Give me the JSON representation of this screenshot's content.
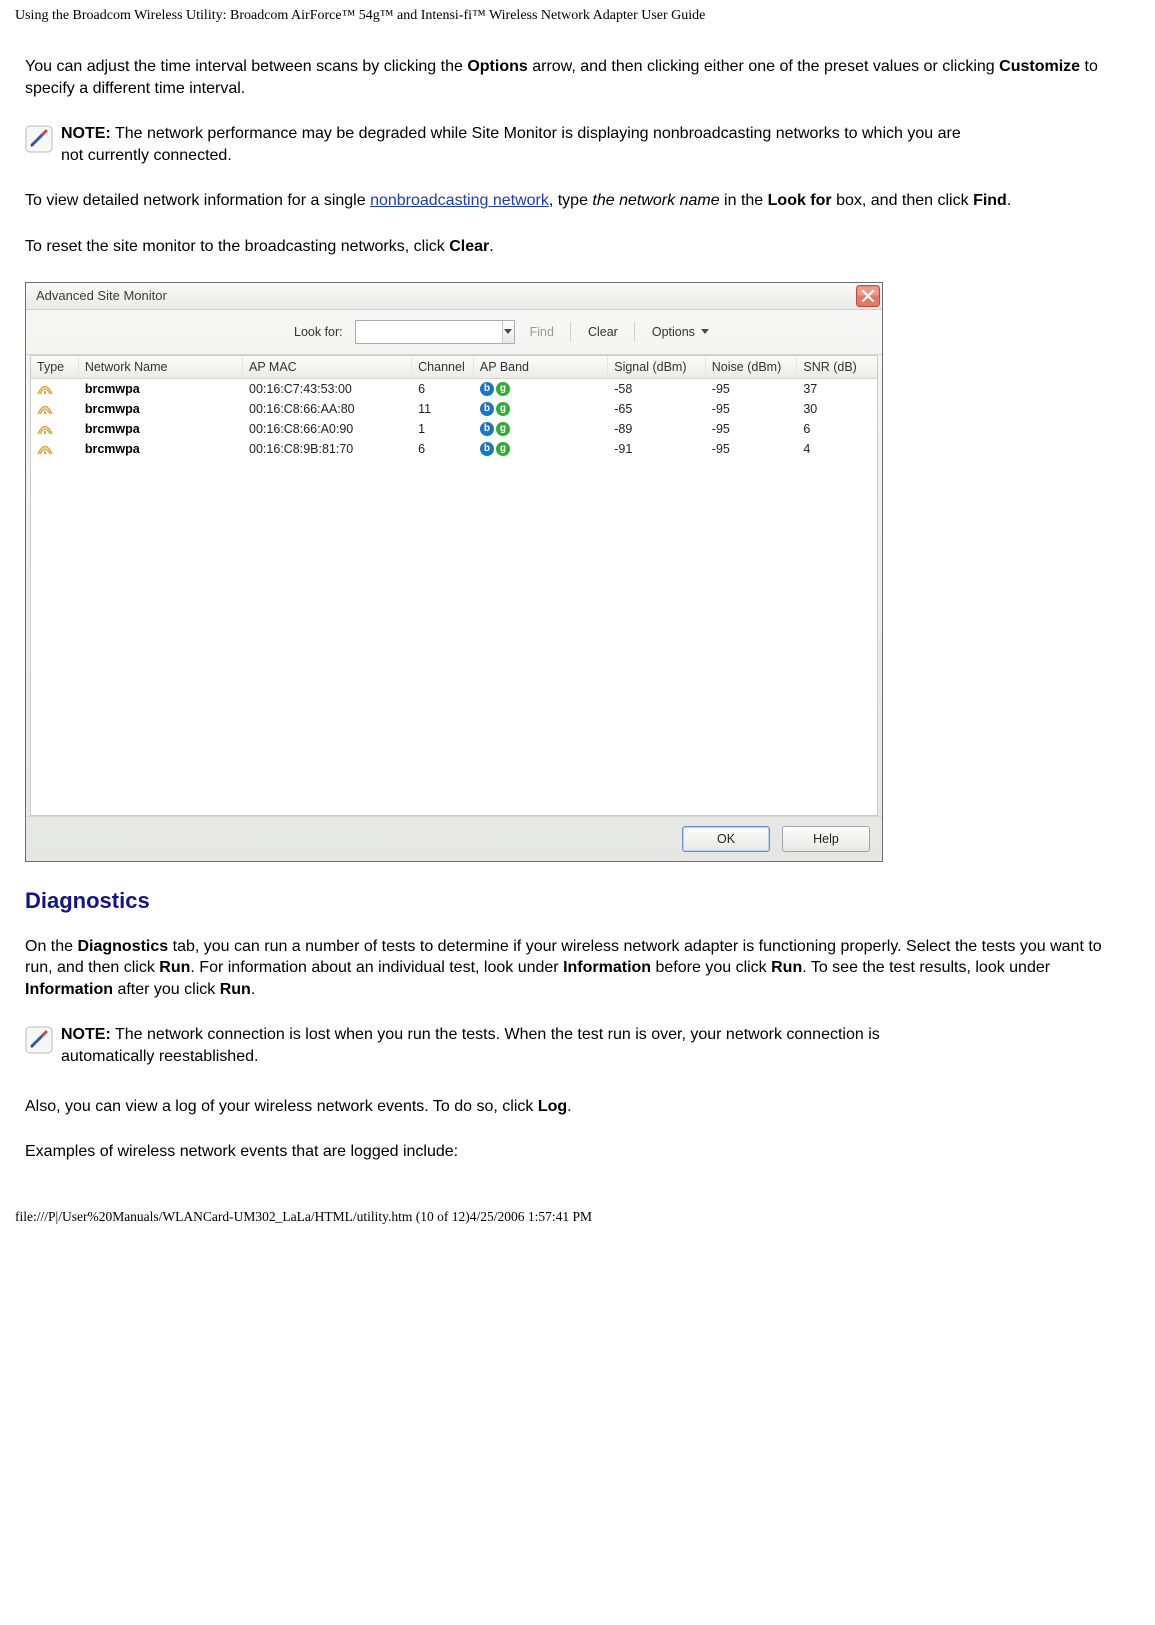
{
  "header": {
    "title": "Using the Broadcom Wireless Utility: Broadcom AirForce™ 54g™ and Intensi-fi™ Wireless Network Adapter User Guide"
  },
  "body": {
    "p1_a": "You can adjust the time interval between scans by clicking the ",
    "p1_b": "Options",
    "p1_c": " arrow, and then clicking either one of the preset values or clicking ",
    "p1_d": "Customize",
    "p1_e": " to specify a different time interval.",
    "note1_label": "NOTE:",
    "note1_text": " The network performance may be degraded while Site Monitor is displaying nonbroadcasting networks to which you are not currently connected.",
    "p2_a": "To view detailed network information for a single ",
    "p2_link": "nonbroadcasting network",
    "p2_b": ", type ",
    "p2_i": "the network name",
    "p2_c": " in the ",
    "p2_d": "Look for",
    "p2_e": " box, and then click ",
    "p2_f": "Find",
    "p2_g": ".",
    "p3_a": "To reset the site monitor to the broadcasting networks, click ",
    "p3_b": "Clear",
    "p3_c": ".",
    "heading_diag": "Diagnostics",
    "p4_a": "On the ",
    "p4_b": "Diagnostics",
    "p4_c": " tab, you can run a number of tests to determine if your wireless network adapter is functioning properly. Select the tests you want to run, and then click ",
    "p4_d": "Run",
    "p4_e": ". For information about an individual test, look under ",
    "p4_f": "Information",
    "p4_g": " before you click ",
    "p4_h": "Run",
    "p4_i": ". To see the test results, look under ",
    "p4_j": "Information",
    "p4_k": " after you click ",
    "p4_l": "Run",
    "p4_m": ".",
    "note2_label": "NOTE:",
    "note2_text": " The network connection is lost when you run the tests. When the test run is over, your network connection is automatically reestablished.",
    "p5_a": "Also, you can view a log of your wireless network events. To do so, click ",
    "p5_b": "Log",
    "p5_c": ".",
    "p6": "Examples of wireless network events that are logged include:"
  },
  "window": {
    "title": "Advanced Site Monitor",
    "toolbar": {
      "look_for_label": "Look for:",
      "find": "Find",
      "clear": "Clear",
      "options": "Options"
    },
    "columns": {
      "type": "Type",
      "name": "Network Name",
      "mac": "AP MAC",
      "channel": "Channel",
      "band": "AP Band",
      "signal": "Signal (dBm)",
      "noise": "Noise (dBm)",
      "snr": "SNR (dB)"
    },
    "rows": [
      {
        "name": "brcmwpa",
        "mac": "00:16:C7:43:53:00",
        "channel": "6",
        "band": "bg",
        "signal": "-58",
        "noise": "-95",
        "snr": "37"
      },
      {
        "name": "brcmwpa",
        "mac": "00:16:C8:66:AA:80",
        "channel": "11",
        "band": "bg",
        "signal": "-65",
        "noise": "-95",
        "snr": "30"
      },
      {
        "name": "brcmwpa",
        "mac": "00:16:C8:66:A0:90",
        "channel": "1",
        "band": "bg",
        "signal": "-89",
        "noise": "-95",
        "snr": "6"
      },
      {
        "name": "brcmwpa",
        "mac": "00:16:C8:9B:81:70",
        "channel": "6",
        "band": "bg",
        "signal": "-91",
        "noise": "-95",
        "snr": "4"
      }
    ],
    "buttons": {
      "ok": "OK",
      "help": "Help"
    }
  },
  "footer": {
    "path": "file:///P|/User%20Manuals/WLANCard-UM302_LaLa/HTML/utility.htm (10 of 12)4/25/2006 1:57:41 PM"
  }
}
